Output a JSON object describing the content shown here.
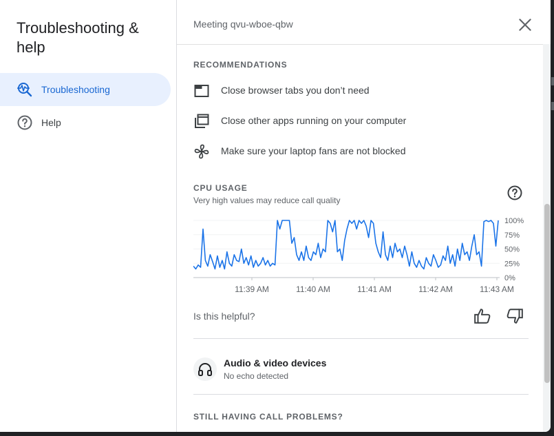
{
  "sidebar": {
    "title": "Troubleshooting & help",
    "items": [
      {
        "label": "Troubleshooting",
        "icon": "troubleshooting-icon",
        "active": true
      },
      {
        "label": "Help",
        "icon": "help-circle-icon",
        "active": false
      }
    ]
  },
  "header": {
    "meeting_title": "Meeting qvu-wboe-qbw",
    "close_icon": "close-icon"
  },
  "recommendations": {
    "label": "RECOMMENDATIONS",
    "items": [
      {
        "icon": "browser-tab-icon",
        "text": "Close browser tabs you don’t need"
      },
      {
        "icon": "app-windows-icon",
        "text": "Close other apps running on your computer"
      },
      {
        "icon": "fan-icon",
        "text": "Make sure your laptop fans are not blocked"
      }
    ]
  },
  "cpu": {
    "label": "CPU USAGE",
    "subtitle": "Very high values may reduce call quality",
    "help_icon": "help-circle-icon"
  },
  "chart_data": {
    "type": "line",
    "title": "CPU USAGE",
    "ylabel": "",
    "xlabel": "",
    "ylim": [
      0,
      100
    ],
    "yticks": [
      "100%",
      "75%",
      "50%",
      "25%",
      "0%"
    ],
    "xticks": [
      "11:39 AM",
      "11:40 AM",
      "11:41 AM",
      "11:42 AM",
      "11:43 AM"
    ],
    "line_color": "#1a73e8",
    "series": [
      {
        "values": [
          20,
          15,
          22,
          18,
          85,
          30,
          20,
          40,
          28,
          15,
          38,
          18,
          30,
          15,
          45,
          25,
          20,
          40,
          30,
          28,
          50,
          25,
          35,
          22,
          38,
          18,
          30,
          20,
          25,
          35,
          22,
          30,
          20,
          25,
          22,
          100,
          85,
          100,
          100,
          100,
          100,
          60,
          70,
          40,
          30,
          45,
          30,
          55,
          35,
          30,
          45,
          40,
          60,
          35,
          50,
          45,
          100,
          95,
          80,
          100,
          45,
          50,
          30,
          65,
          85,
          100,
          95,
          100,
          85,
          100,
          95,
          100,
          90,
          70,
          100,
          95,
          60,
          45,
          35,
          80,
          40,
          30,
          55,
          35,
          60,
          45,
          50,
          35,
          55,
          40,
          20,
          45,
          25,
          18,
          30,
          20,
          15,
          35,
          25,
          20,
          40,
          30,
          18,
          22,
          38,
          30,
          55,
          25,
          40,
          20,
          50,
          30,
          60,
          40,
          45,
          30,
          55,
          75,
          40,
          45,
          20,
          98,
          100,
          98,
          100,
          95,
          55,
          100
        ]
      }
    ]
  },
  "feedback": {
    "question": "Is this helpful?",
    "thumb_up_icon": "thumb-up-icon",
    "thumb_down_icon": "thumb-down-icon"
  },
  "devices": {
    "icon": "headset-icon",
    "title": "Audio & video devices",
    "subtitle": "No echo detected"
  },
  "still_problems": {
    "label": "STILL HAVING CALL PROBLEMS?"
  }
}
